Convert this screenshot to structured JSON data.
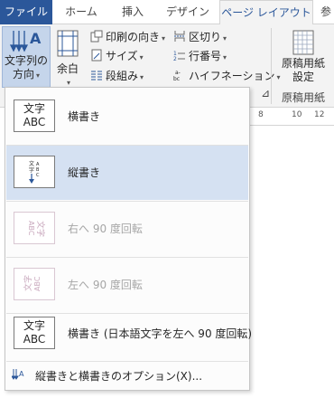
{
  "tabs": [
    "ファイル",
    "ホーム",
    "挿入",
    "デザイン",
    "ページ レイアウト",
    "参"
  ],
  "ribbon": {
    "text_direction": {
      "line1": "文字列の",
      "line2": "方向",
      "caret": "▾"
    },
    "margins": {
      "label": "余白",
      "caret": "▾"
    },
    "orientation": {
      "label": "印刷の向き",
      "caret": "▾"
    },
    "size": {
      "label": "サイズ",
      "caret": "▾"
    },
    "columns": {
      "label": "段組み",
      "caret": "▾"
    },
    "breaks": {
      "label": "区切り",
      "caret": "▾"
    },
    "line_numbers": {
      "label": "行番号",
      "caret": "▾"
    },
    "hyphenation": {
      "label": "ハイフネーション",
      "caret": "▾"
    },
    "manuscript": {
      "line1": "原稿用紙",
      "line2": "設定"
    },
    "manuscript_group": "原稿用紙",
    "dialog_launcher": "⊿"
  },
  "ruler": [
    "8",
    "10",
    "12"
  ],
  "menu": {
    "items": [
      {
        "label": "横書き",
        "thumb_top": "文字",
        "thumb_bottom": "ABC",
        "enabled": true,
        "selected": false
      },
      {
        "label": "縦書き",
        "enabled": true,
        "selected": true
      },
      {
        "label": "右へ 90 度回転",
        "enabled": false,
        "selected": false
      },
      {
        "label": "左へ 90 度回転",
        "enabled": false,
        "selected": false
      },
      {
        "label": "横書き (日本語文字を左へ 90 度回転)",
        "thumb_top": "文字",
        "thumb_bottom": "ABC",
        "enabled": true,
        "selected": false
      }
    ],
    "footer": "縦書きと横書きのオプション(X)..."
  }
}
